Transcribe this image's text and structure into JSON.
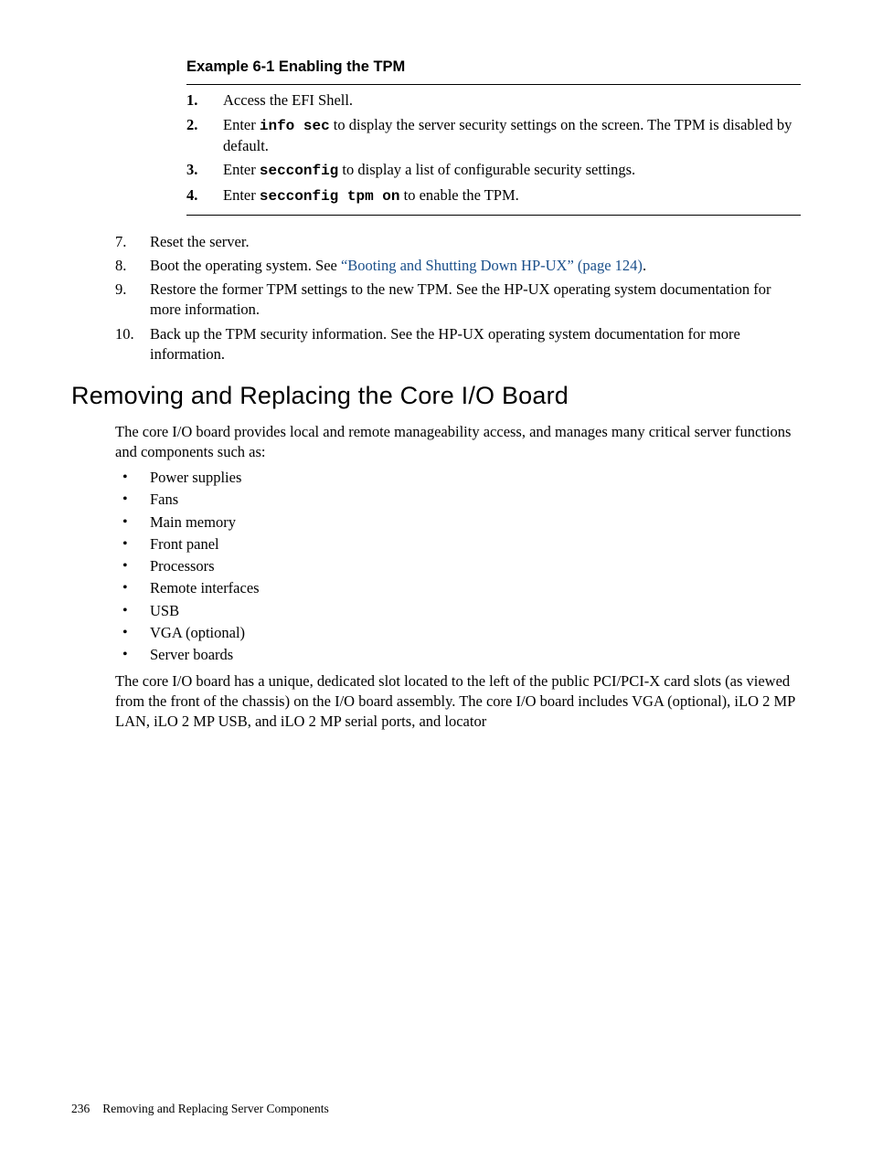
{
  "example": {
    "heading": "Example 6-1 Enabling the TPM",
    "steps": {
      "s1": "Access the EFI Shell.",
      "s2_a": "Enter ",
      "s2_code": "info sec",
      "s2_b": " to display the server security settings on the screen. The TPM is disabled by default.",
      "s3_a": "Enter ",
      "s3_code": "secconfig",
      "s3_b": " to display a list of configurable security settings.",
      "s4_a": "Enter ",
      "s4_code": "secconfig tpm on",
      "s4_b": " to enable the TPM."
    }
  },
  "outer_steps": {
    "n7": "7.",
    "t7": "Reset the server.",
    "n8": "8.",
    "t8_a": "Boot the operating system. See ",
    "t8_link": "“Booting and Shutting Down HP-UX” (page 124)",
    "t8_b": ".",
    "n9": "9.",
    "t9": "Restore the former TPM settings to the new TPM. See the HP-UX operating system documentation for more information.",
    "n10": "10.",
    "t10": "Back up the TPM security information. See the HP-UX operating system documentation for more information."
  },
  "section": {
    "heading": "Removing and Replacing the Core I/O Board",
    "intro": "The core I/O board provides local and remote manageability access, and manages many critical server functions and components such as:",
    "bullets": {
      "b1": "Power supplies",
      "b2": "Fans",
      "b3": "Main memory",
      "b4": "Front panel",
      "b5": "Processors",
      "b6": "Remote interfaces",
      "b7": "USB",
      "b8": "VGA (optional)",
      "b9": "Server boards"
    },
    "para2": "The core I/O board has a unique, dedicated slot located to the left of the public PCI/PCI-X card slots (as viewed from the front of the chassis) on the I/O board assembly. The core I/O board includes VGA (optional), iLO 2 MP LAN, iLO 2 MP USB, and iLO 2 MP serial ports, and locator"
  },
  "footer": {
    "page_number": "236",
    "chapter": "Removing and Replacing Server Components"
  }
}
